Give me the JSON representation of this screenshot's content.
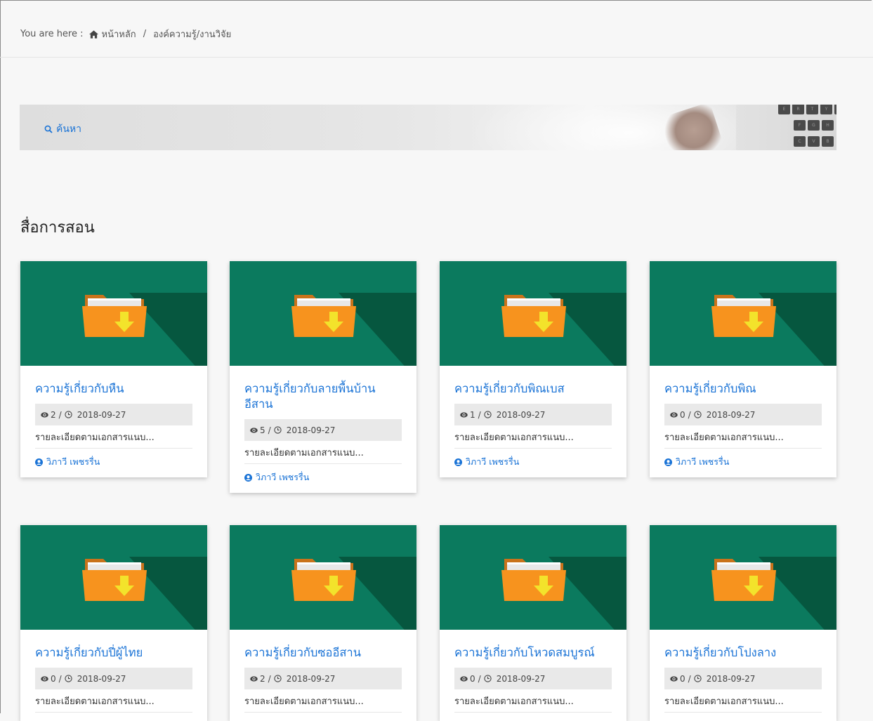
{
  "breadcrumb": {
    "prefix": "You are here :",
    "home_label": "หน้าหลัก",
    "separator": "/",
    "current": "องค์ความรู้/งานวิจัย"
  },
  "search": {
    "label": "ค้นหา"
  },
  "banner_keys": [
    "E",
    "R",
    "T",
    "Y",
    "U",
    "F",
    "G",
    "H",
    "C",
    "V",
    "B"
  ],
  "section": {
    "title": "สื่อการสอน"
  },
  "colors": {
    "link": "#1a73d6",
    "thumb_bg": "#0b7a5e",
    "thumb_shadow": "#06573f",
    "folder": "#f7931e",
    "arrow": "#f3e32b"
  },
  "cards": [
    {
      "title": "ความรู้เกี่ยวกับหืน",
      "views": "2",
      "date": "2018-09-27",
      "desc": "รายละเอียดตามเอกสารแนบ...",
      "author": "วิภาวี เพชรรื่น"
    },
    {
      "title": "ความรู้เกี่ยวกับลายพื้นบ้านอีสาน",
      "views": "5",
      "date": "2018-09-27",
      "desc": "รายละเอียดตามเอกสารแนบ...",
      "author": "วิภาวี เพชรรื่น"
    },
    {
      "title": "ความรู้เกี่ยวกับพิณเบส",
      "views": "1",
      "date": "2018-09-27",
      "desc": "รายละเอียดตามเอกสารแนบ...",
      "author": "วิภาวี เพชรรื่น"
    },
    {
      "title": "ความรู้เกี่ยวกับพิณ",
      "views": "0",
      "date": "2018-09-27",
      "desc": "รายละเอียดตามเอกสารแนบ...",
      "author": "วิภาวี เพชรรื่น"
    },
    {
      "title": "ความรู้เกี่ยวกับปี่ผู้ไทย",
      "views": "0",
      "date": "2018-09-27",
      "desc": "รายละเอียดตามเอกสารแนบ...",
      "author": ""
    },
    {
      "title": "ความรู้เกี่ยวกับซออีสาน",
      "views": "2",
      "date": "2018-09-27",
      "desc": "รายละเอียดตามเอกสารแนบ...",
      "author": ""
    },
    {
      "title": "ความรู้เกี่ยวกับโหวดสมบูรณ์",
      "views": "0",
      "date": "2018-09-27",
      "desc": "รายละเอียดตามเอกสารแนบ...",
      "author": ""
    },
    {
      "title": "ความรู้เกี่ยวกับโปงลาง",
      "views": "0",
      "date": "2018-09-27",
      "desc": "รายละเอียดตามเอกสารแนบ...",
      "author": ""
    }
  ]
}
